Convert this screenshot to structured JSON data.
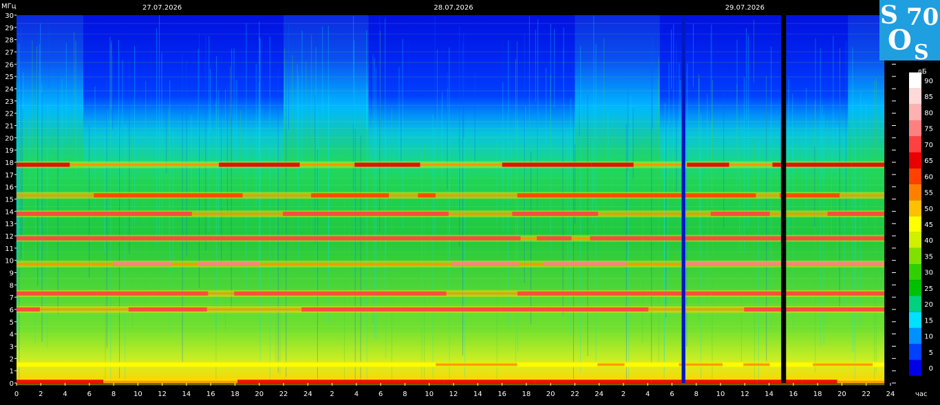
{
  "chart_data": {
    "type": "heatmap",
    "title": "",
    "y_axis_unit": "МГц",
    "x_axis_unit": "час",
    "colorbar_unit": "дБ",
    "ylim": [
      0,
      30
    ],
    "y_ticks": [
      0,
      1,
      2,
      3,
      4,
      5,
      6,
      7,
      8,
      9,
      10,
      11,
      12,
      13,
      14,
      15,
      16,
      17,
      18,
      19,
      20,
      21,
      22,
      23,
      24,
      25,
      26,
      27,
      28,
      29,
      30
    ],
    "xlim": [
      0,
      72
    ],
    "x_ticks": [
      0,
      2,
      4,
      6,
      8,
      10,
      12,
      14,
      16,
      18,
      20,
      22,
      24,
      26,
      28,
      30,
      32,
      34,
      36,
      38,
      40,
      42,
      44,
      46,
      48,
      50,
      52,
      54,
      56,
      58,
      60,
      62,
      64,
      66,
      68,
      70,
      72
    ],
    "x_tick_labels": [
      "0",
      "2",
      "4",
      "6",
      "8",
      "10",
      "12",
      "14",
      "16",
      "18",
      "20",
      "22",
      "24",
      "2",
      "4",
      "6",
      "8",
      "10",
      "12",
      "14",
      "16",
      "18",
      "20",
      "22",
      "24",
      "2",
      "4",
      "6",
      "8",
      "10",
      "12",
      "14",
      "16",
      "18",
      "20",
      "22",
      "24"
    ],
    "dates": [
      {
        "label": "27.07.2026",
        "hour": 12
      },
      {
        "label": "28.07.2026",
        "hour": 36
      },
      {
        "label": "29.07.2026",
        "hour": 60
      }
    ],
    "data_end_hour": 71.5,
    "colorbar": {
      "levels": [
        0,
        5,
        10,
        15,
        20,
        25,
        30,
        35,
        40,
        45,
        50,
        55,
        60,
        65,
        70,
        75,
        80,
        85,
        90
      ],
      "colors": [
        "#0000e6",
        "#0040ff",
        "#0090ff",
        "#00e0ff",
        "#00d080",
        "#00c000",
        "#30d000",
        "#80e000",
        "#d0f000",
        "#ffff00",
        "#ffc000",
        "#ff8000",
        "#ff4000",
        "#e80000",
        "#ff4040",
        "#ff8080",
        "#ffb0b0",
        "#ffd8d8",
        "#ffffff"
      ]
    },
    "night_windows_hours": [
      [
        5.5,
        22
      ],
      [
        29,
        46
      ],
      [
        53,
        68.5
      ]
    ],
    "data_gaps_hours": [
      [
        54.8,
        55.1
      ],
      [
        63.0,
        63.4
      ]
    ],
    "strong_bands_mhz": [
      {
        "freq": 0.1,
        "level": 65
      },
      {
        "freq": 1.5,
        "level": 45
      },
      {
        "freq": 6.0,
        "level": 70
      },
      {
        "freq": 7.3,
        "level": 70
      },
      {
        "freq": 9.7,
        "level": 75
      },
      {
        "freq": 11.8,
        "level": 70
      },
      {
        "freq": 13.8,
        "level": 70
      },
      {
        "freq": 15.3,
        "level": 60
      },
      {
        "freq": 17.8,
        "level": 65
      }
    ]
  },
  "logo": {
    "text_s1": "S",
    "text_o": "O",
    "text_s2": "S",
    "text_num": "70",
    "bg_color": "#1f9ee0"
  }
}
